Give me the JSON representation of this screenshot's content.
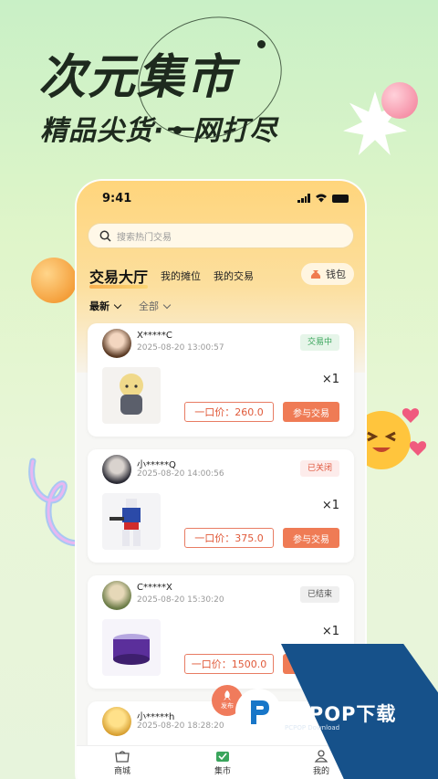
{
  "promo": {
    "title": "次元集市",
    "subtitle": "精品尖货·一网打尽"
  },
  "status": {
    "time": "9:41"
  },
  "search": {
    "placeholder": "搜索热门交易"
  },
  "tabs": {
    "main": "交易大厅",
    "stalls": "我的摊位",
    "my_trades": "我的交易"
  },
  "wallet": {
    "label": "钱包"
  },
  "filters": {
    "sort": "最新",
    "category": "全部"
  },
  "listings": [
    {
      "user": "X*****C",
      "time": "2025-08-20 13:00:57",
      "status": "交易中",
      "qty": "×1",
      "price": "一口价：260.0",
      "action": "参与交易"
    },
    {
      "user": "小*****Q",
      "time": "2025-08-20 14:00:56",
      "status": "已关闭",
      "qty": "×1",
      "price": "一口价：375.0",
      "action": "参与交易"
    },
    {
      "user": "C*****X",
      "time": "2025-08-20 15:30:20",
      "status": "已结束",
      "qty": "×1",
      "price": "一口价：1500.0",
      "action": "参与交易"
    },
    {
      "user": "小*****h",
      "time": "2025-08-20 18:28:20"
    }
  ],
  "fab": {
    "label": "发布"
  },
  "tabbar": {
    "shop": "商城",
    "market": "集市",
    "mine": "我的"
  },
  "watermark": {
    "brand": "PCPOP下载",
    "sub": "PCPOP Download"
  },
  "colors": {
    "accent": "#ef7b55",
    "trading": "#3aa55c",
    "closed": "#e0543a",
    "ended": "#555555"
  }
}
